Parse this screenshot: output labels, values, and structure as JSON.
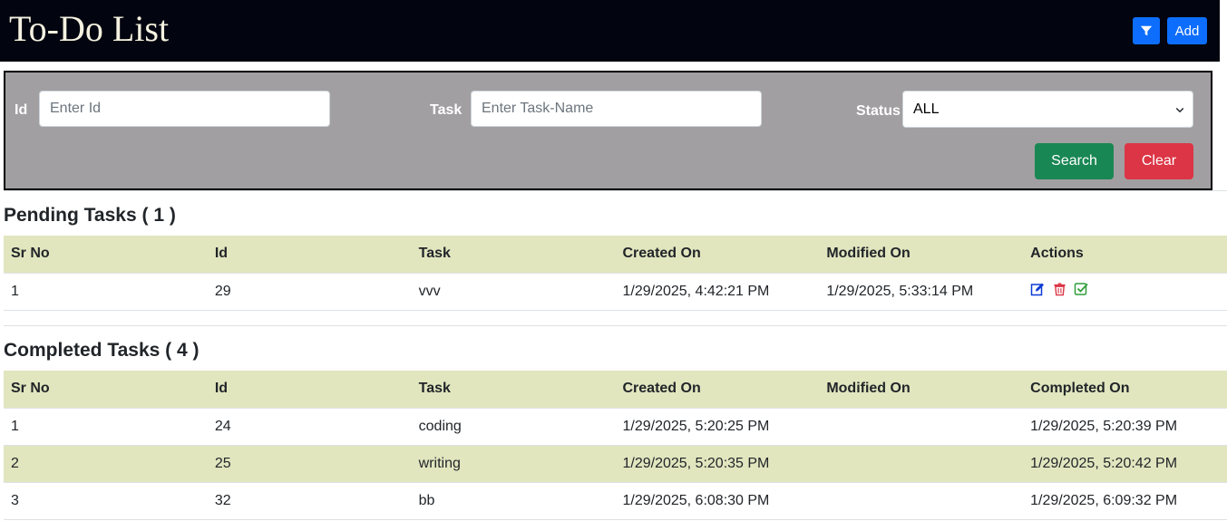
{
  "header": {
    "title": "To-Do List",
    "filter_icon": "funnel-icon",
    "add_label": "Add"
  },
  "filters": {
    "id_label": "Id",
    "id_placeholder": "Enter Id",
    "task_label": "Task",
    "task_placeholder": "Enter Task-Name",
    "status_label": "Status",
    "status_value": "ALL",
    "search_label": "Search",
    "clear_label": "Clear"
  },
  "pending": {
    "title": "Pending Tasks ( 1 )",
    "columns": [
      "Sr No",
      "Id",
      "Task",
      "Created On",
      "Modified On",
      "Actions"
    ],
    "rows": [
      [
        "1",
        "29",
        "vvv",
        "1/29/2025, 4:42:21 PM",
        "1/29/2025, 5:33:14 PM"
      ]
    ],
    "action_icons": [
      "edit-icon",
      "trash-icon",
      "check-square-icon"
    ]
  },
  "completed": {
    "title": "Completed Tasks ( 4 )",
    "columns": [
      "Sr No",
      "Id",
      "Task",
      "Created On",
      "Modified On",
      "Completed On"
    ],
    "rows": [
      [
        "1",
        "24",
        "coding",
        "1/29/2025, 5:20:25 PM",
        "",
        "1/29/2025, 5:20:39 PM"
      ],
      [
        "2",
        "25",
        "writing",
        "1/29/2025, 5:20:35 PM",
        "",
        "1/29/2025, 5:20:42 PM"
      ],
      [
        "3",
        "32",
        "bb",
        "1/29/2025, 6:08:30 PM",
        "",
        "1/29/2025, 6:09:32 PM"
      ]
    ]
  },
  "colors": {
    "header_bg": "#02040f",
    "primary": "#0d6efd",
    "success": "#198754",
    "danger": "#dc3545",
    "panel_bg": "#a19fa1",
    "row_highlight": "#e2e6bf"
  }
}
